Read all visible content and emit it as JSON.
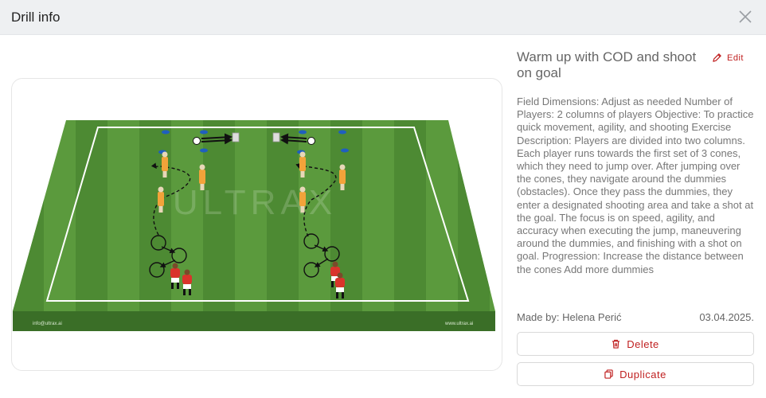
{
  "header": {
    "title": "Drill info"
  },
  "drill": {
    "title": "Warm up with COD and shoot on goal",
    "edit_label": "Edit",
    "description": "Field Dimensions: Adjust as needed Number of Players: 2 columns of players Objective: To practice quick movement, agility, and shooting Exercise Description: Players are divided into two columns. Each player runs towards the first set of 3 cones, which they need to jump over. After jumping over the cones, they navigate around the dummies (obstacles). Once they pass the dummies, they enter a designated shooting area and take a shot at the goal. The focus is on speed, agility, and accuracy when executing the jump, maneuvering around the dummies, and finishing with a shot on goal. Progression: Increase the distance between the cones Add more dummies",
    "made_by": "Made by: Helena Perić",
    "date": "03.04.2025."
  },
  "image": {
    "watermark": "ULTRAX",
    "footer_left": "info@ultrax.ai",
    "footer_right": "www.ultrax.ai"
  },
  "actions": {
    "delete_label": "Delete",
    "duplicate_label": "Duplicate"
  },
  "colors": {
    "accent": "#c02020",
    "pitch_light": "#5b9a3d",
    "pitch_dark": "#4d8a33",
    "player_orange": "#f2a33a",
    "player_red": "#d9342b",
    "cone_blue": "#1f5fbf"
  }
}
